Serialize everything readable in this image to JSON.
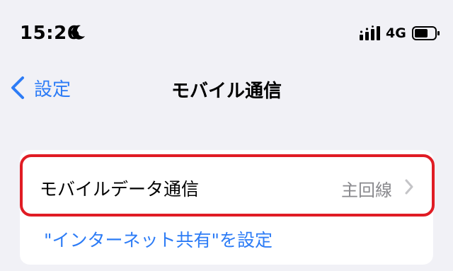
{
  "status_bar": {
    "time": "15:26",
    "network": "4G",
    "icons": [
      "moon-icon",
      "cellular-signal-icon",
      "battery-icon"
    ]
  },
  "nav": {
    "back_label": "設定",
    "title": "モバイル通信"
  },
  "cellular_group": {
    "mobile_data_label": "モバイルデータ通信",
    "mobile_data_value": "主回線",
    "hotspot_link": "\"インターネット共有\"を設定"
  },
  "colors": {
    "accent": "#2d7cf6",
    "highlight": "#e01c24",
    "background": "#f1f1f6",
    "secondary_text": "#8a8a8e"
  }
}
